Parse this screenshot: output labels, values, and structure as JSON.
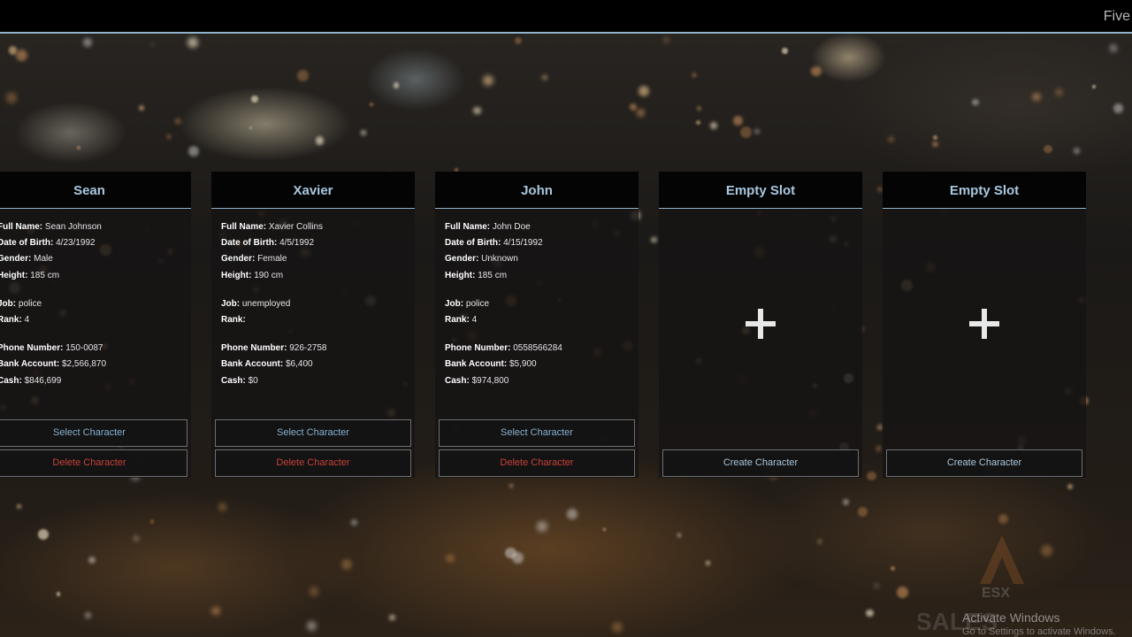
{
  "app": {
    "title": "Five"
  },
  "characters": [
    {
      "name": "Sean",
      "full_name_label": "Full Name:",
      "full_name": "Sean Johnson",
      "dob_label": "Date of Birth:",
      "dob": "4/23/1992",
      "gender_label": "Gender:",
      "gender": "Male",
      "height_label": "Height:",
      "height": "185 cm",
      "job_label": "Job:",
      "job": "police",
      "rank_label": "Rank:",
      "rank": "4",
      "phone_label": "Phone Number:",
      "phone": "150-0087",
      "bank_label": "Bank Account:",
      "bank": "$2,566,870",
      "cash_label": "Cash:",
      "cash": "$846,699",
      "select_label": "Select Character",
      "delete_label": "Delete Character"
    },
    {
      "name": "Xavier",
      "full_name_label": "Full Name:",
      "full_name": "Xavier Collins",
      "dob_label": "Date of Birth:",
      "dob": "4/5/1992",
      "gender_label": "Gender:",
      "gender": "Female",
      "height_label": "Height:",
      "height": "190 cm",
      "job_label": "Job:",
      "job": "unemployed",
      "rank_label": "Rank:",
      "rank": "",
      "phone_label": "Phone Number:",
      "phone": "926-2758",
      "bank_label": "Bank Account:",
      "bank": "$6,400",
      "cash_label": "Cash:",
      "cash": "$0",
      "select_label": "Select Character",
      "delete_label": "Delete Character"
    },
    {
      "name": "John",
      "full_name_label": "Full Name:",
      "full_name": "John Doe",
      "dob_label": "Date of Birth:",
      "dob": "4/15/1992",
      "gender_label": "Gender:",
      "gender": "Unknown",
      "height_label": "Height:",
      "height": "185 cm",
      "job_label": "Job:",
      "job": "police",
      "rank_label": "Rank:",
      "rank": "4",
      "phone_label": "Phone Number:",
      "phone": "0558566284",
      "bank_label": "Bank Account:",
      "bank": "$5,900",
      "cash_label": "Cash:",
      "cash": "$974,800",
      "select_label": "Select Character",
      "delete_label": "Delete Character"
    }
  ],
  "empty_slots": [
    {
      "title": "Empty Slot",
      "icon": "plus-icon",
      "create_label": "Create Character"
    },
    {
      "title": "Empty Slot",
      "icon": "plus-icon",
      "create_label": "Create Character"
    }
  ],
  "overlay": {
    "activation_title": "Activate Windows",
    "activation_sub": "Go to Settings to activate Windows.",
    "logo_text": "ESX",
    "watermark_text": "SALES"
  },
  "colors": {
    "accent": "#a9c7df",
    "delete": "#c8413b",
    "header_bg": "#040404"
  }
}
